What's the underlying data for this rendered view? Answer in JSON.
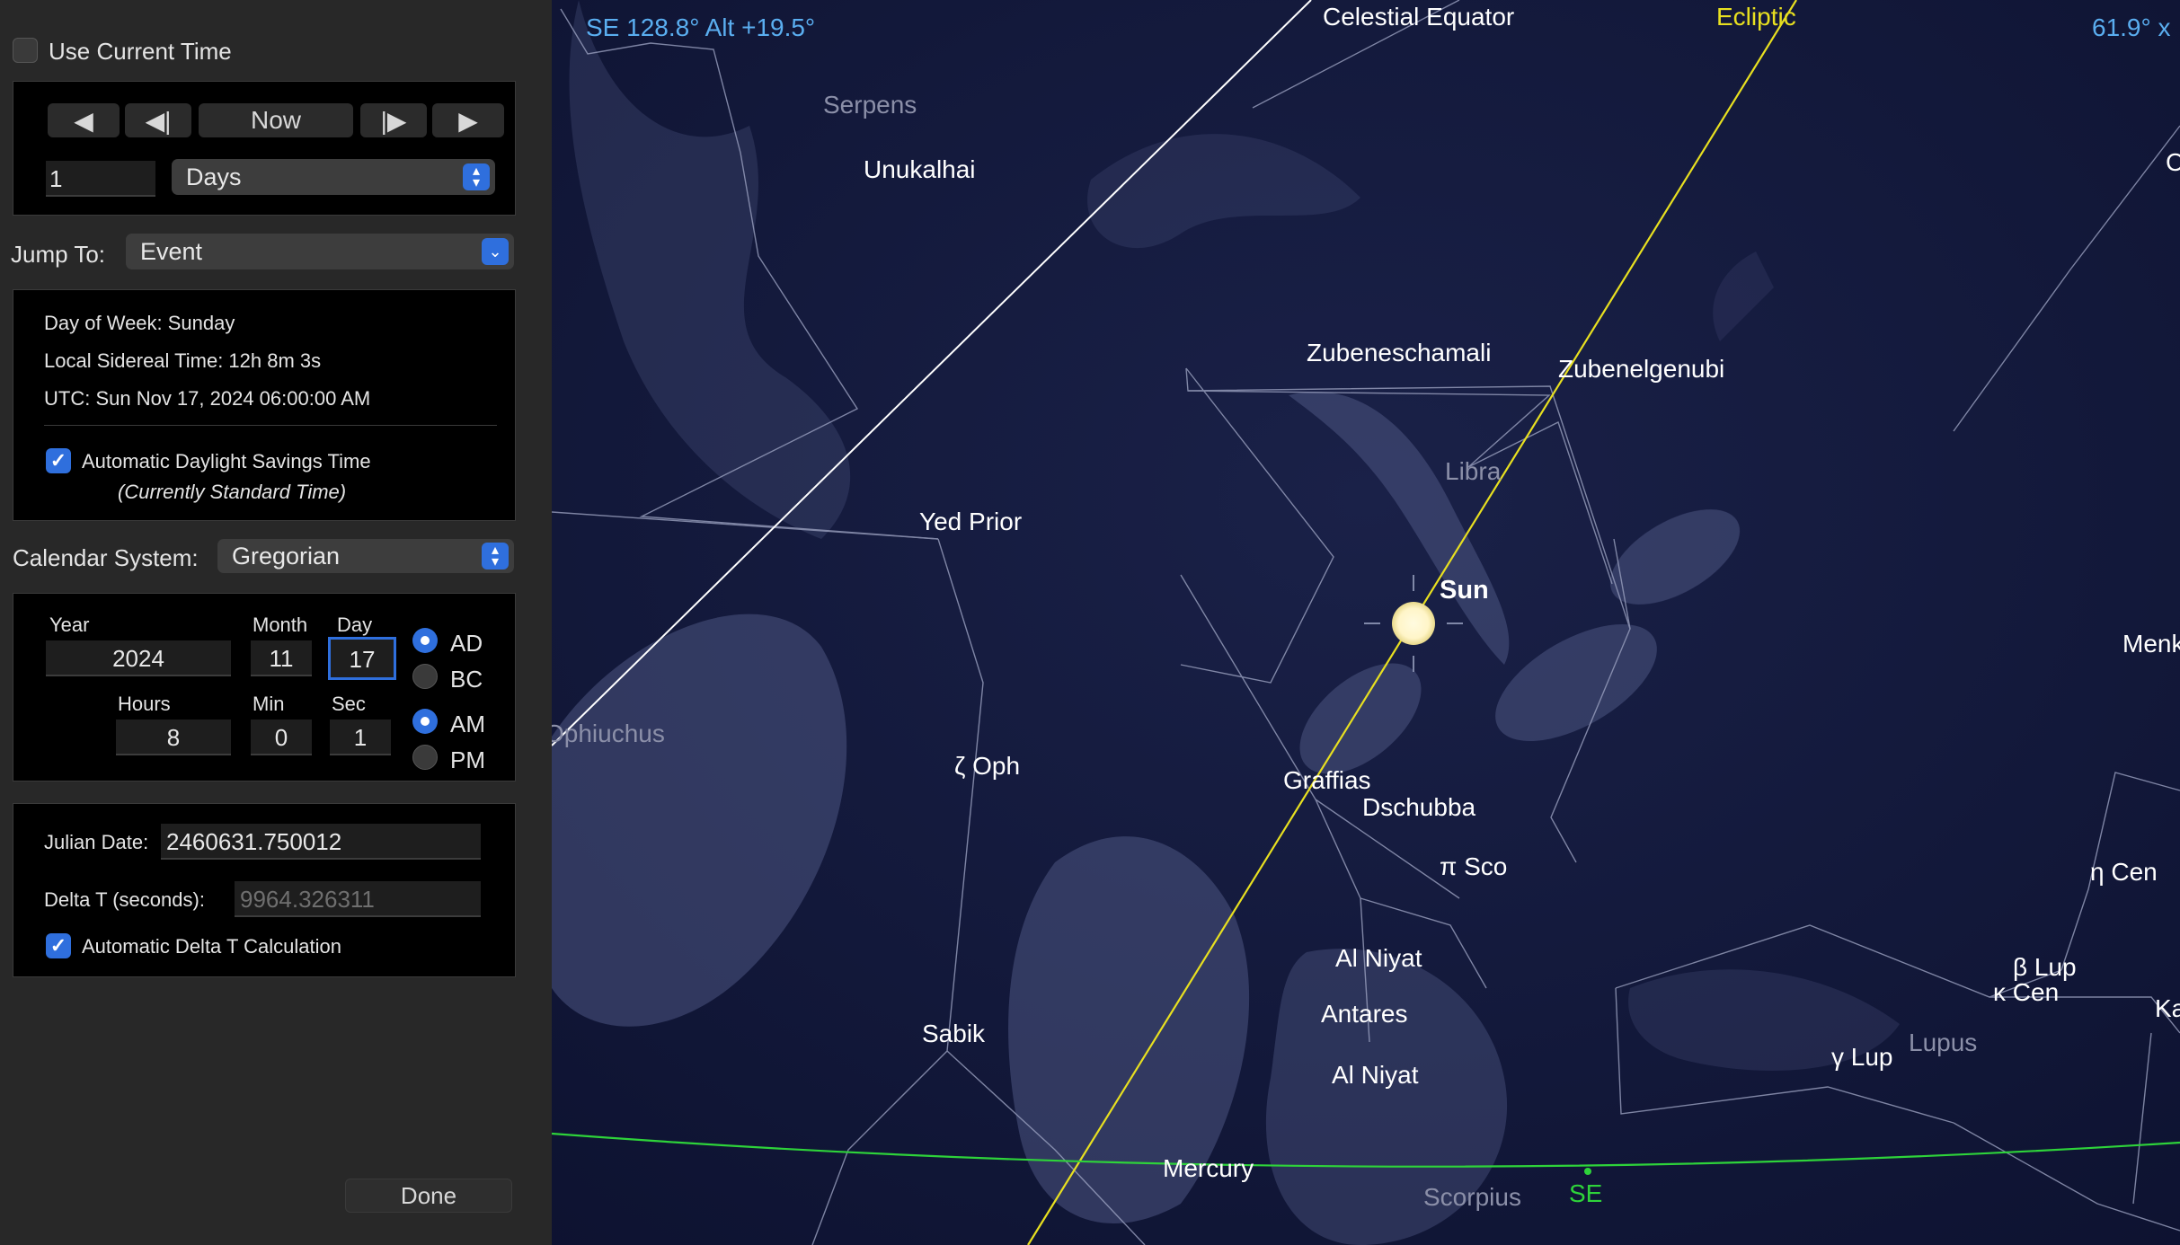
{
  "panel": {
    "use_current_time": "Use Current Time",
    "step": {
      "back_label": "◀",
      "step_back_label": "◀|",
      "now_label": "Now",
      "step_fwd_label": "|▶",
      "fwd_label": "▶",
      "amount": "1",
      "unit": "Days"
    },
    "jump_to_label": "Jump To:",
    "jump_to_value": "Event",
    "info": {
      "day_of_week": "Day of Week:  Sunday",
      "sidereal": "Local Sidereal Time:  12h 8m 3s",
      "utc": "UTC:  Sun Nov 17, 2024   06:00:00 AM",
      "dst_label": "Automatic Daylight Savings Time",
      "dst_note": "(Currently Standard Time)"
    },
    "calendar_label": "Calendar System:",
    "calendar_value": "Gregorian",
    "date": {
      "year_label": "Year",
      "year": "2024",
      "month_label": "Month",
      "month": "11",
      "day_label": "Day",
      "day": "17",
      "ad": "AD",
      "bc": "BC",
      "hours_label": "Hours",
      "hours": "8",
      "min_label": "Min",
      "min": "0",
      "sec_label": "Sec",
      "sec": "1",
      "am": "AM",
      "pm": "PM"
    },
    "julian": {
      "label": "Julian Date:",
      "value": "2460631.750012",
      "delta_label": "Delta T (seconds):",
      "delta_value": "9964.326311",
      "auto_delta": "Automatic Delta T Calculation"
    },
    "done_label": "Done"
  },
  "sky": {
    "direction_readout": "SE 128.8° Alt +19.5°",
    "fov_readout": "61.9° x",
    "celestial_equator": "Celestial Equator",
    "ecliptic": "Ecliptic",
    "horizon_direction": "SE",
    "colors": {
      "equator": "#ffffff",
      "ecliptic": "#e8e020",
      "horizon": "#2ed33a",
      "readout": "#5aaef0"
    },
    "constellations": [
      "Serpens",
      "Libra",
      "Ophiuchus",
      "Lupus",
      "Scorpius"
    ],
    "stars": [
      "Unukalhai",
      "Yed Prior",
      "ζ Oph",
      "Sabik",
      "Zubeneschamali",
      "Zubenelgenubi",
      "Graffias",
      "Dschubba",
      "π Sco",
      "Al Niyat",
      "Antares",
      "Al Niyat",
      "Mercury",
      "Menk",
      "η Cen",
      "β Lup",
      "κ Cen",
      "γ Lup",
      "Ka",
      "C"
    ],
    "sun_label": "Sun"
  }
}
